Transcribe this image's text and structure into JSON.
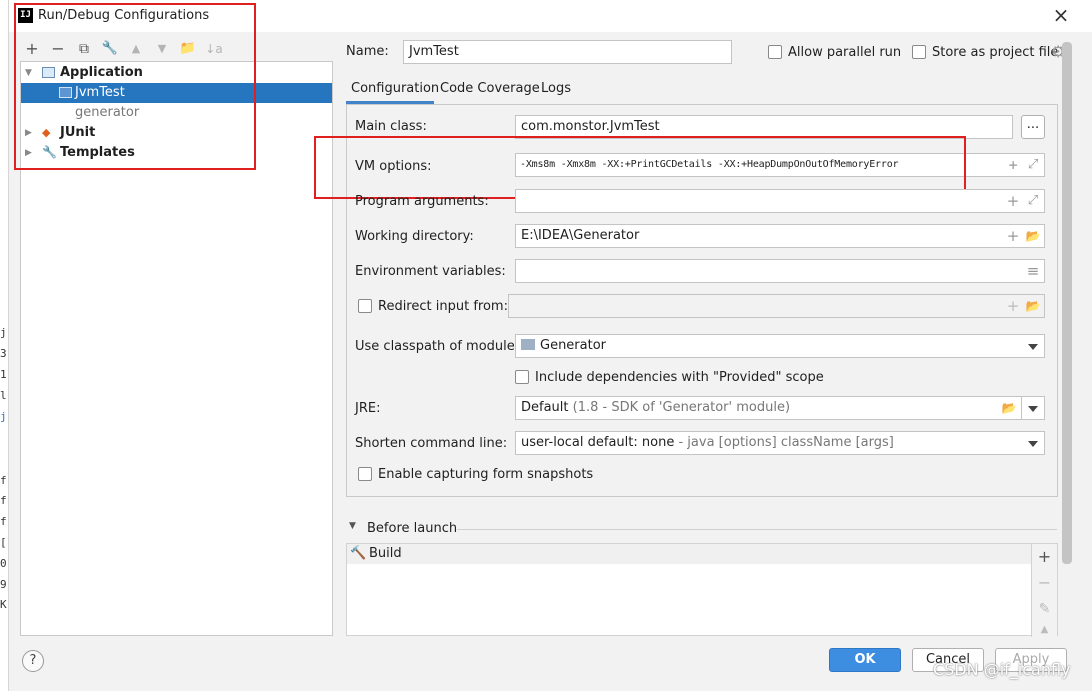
{
  "window": {
    "title": "Run/Debug Configurations",
    "app_icon_text": "IJ"
  },
  "backstrip": [
    "j",
    "3",
    "1",
    "l",
    "j",
    "f",
    "f",
    "f",
    "[",
    "0",
    "9",
    "K"
  ],
  "toolbar": {
    "add": "+",
    "remove": "−",
    "copy": "⧉",
    "edit": "🔧",
    "up": "▲",
    "down": "▼",
    "folder": "📁",
    "sort": "↓a"
  },
  "tree": {
    "application": "Application",
    "jvmtest": "JvmTest",
    "generator": "generator",
    "junit": "JUnit",
    "templates": "Templates"
  },
  "form": {
    "name_label": "Name:",
    "name_value": "JvmTest",
    "allow_parallel": "Allow parallel run",
    "store_project": "Store as project file",
    "tabs": [
      "Configuration",
      "Code Coverage",
      "Logs"
    ],
    "main_class_label": "Main class:",
    "main_class_value": "com.monstor.JvmTest",
    "browse_button": "...",
    "vm_options_label": "VM options:",
    "vm_options_value": "-Xms8m -Xmx8m -XX:+PrintGCDetails -XX:+HeapDumpOnOutOfMemoryError",
    "program_args_label": "Program arguments:",
    "working_dir_label": "Working directory:",
    "working_dir_value": "E:\\IDEA\\Generator",
    "env_vars_label": "Environment variables:",
    "redirect_label": "Redirect input from:",
    "classpath_label": "Use classpath of module:",
    "classpath_value": "Generator",
    "include_deps": "Include dependencies with \"Provided\" scope",
    "jre_label": "JRE:",
    "jre_value": "Default",
    "jre_detail": "(1.8 - SDK of 'Generator' module)",
    "shorten_label": "Shorten command line:",
    "shorten_value": "user-local default: none",
    "shorten_detail": "- java [options] className [args]",
    "enable_snapshots": "Enable capturing form snapshots"
  },
  "before_launch": {
    "title": "Before launch",
    "items": [
      "Build"
    ]
  },
  "side_tools": {
    "add": "+",
    "remove": "−",
    "edit": "✎",
    "up": "▲"
  },
  "icons": {
    "plus": "+",
    "expand": "⤢",
    "folder": "📂",
    "list": "≡"
  },
  "buttons": {
    "ok": "OK",
    "cancel": "Cancel",
    "apply": "Apply",
    "help": "?"
  },
  "watermark": "CSDN @if_icanfly",
  "colors": {
    "selection": "#2675bf",
    "highlight_box": "#e02020",
    "ok_button": "#3d8ee0"
  }
}
